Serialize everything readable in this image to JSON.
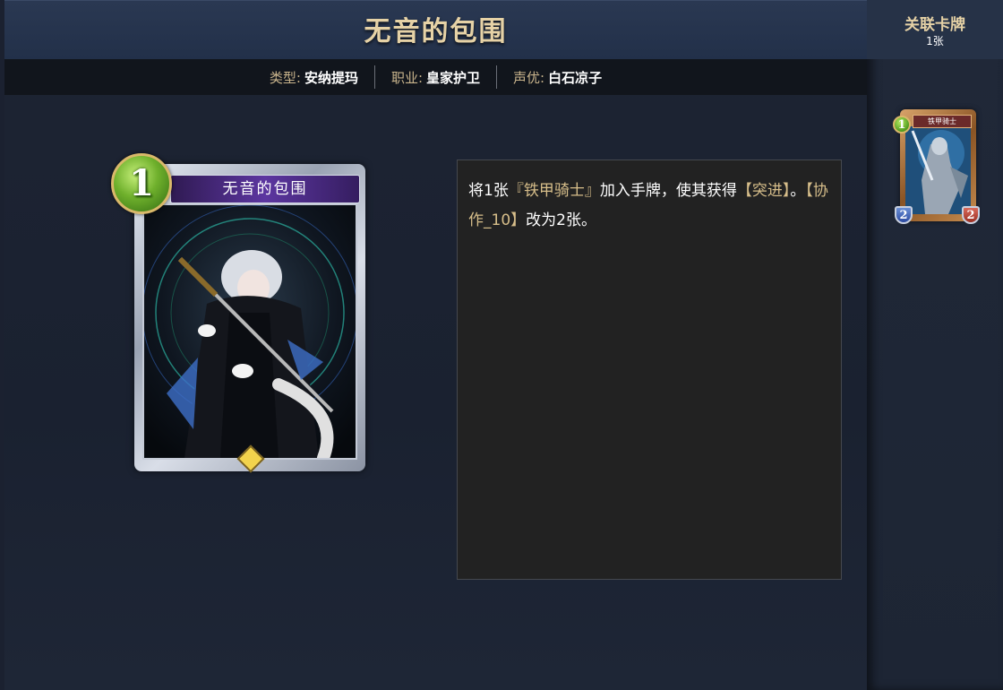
{
  "card": {
    "name": "无音的包围",
    "cost": "1"
  },
  "meta": {
    "type_label": "类型:",
    "type_value": "安纳提玛",
    "class_label": "职业:",
    "class_value": "皇家护卫",
    "cv_label": "声优:",
    "cv_value": "白石凉子"
  },
  "description": {
    "part1": "将1张",
    "linked_card": "『铁甲骑士』",
    "part2": "加入手牌，使其获得",
    "keyword1": "【突进】",
    "part3": "。",
    "keyword2": "【协作_10】",
    "part4": "改为2张。"
  },
  "related": {
    "title": "关联卡牌",
    "count": "1张",
    "cards": [
      {
        "name": "铁甲骑士",
        "cost": "1",
        "attack": "2",
        "defense": "2"
      }
    ]
  },
  "colors": {
    "gold_text": "#e6d2a6",
    "keyword_highlight": "#d7be8a",
    "cost_gem_green": "#6fb02c",
    "name_banner_purple": "#5c36a0"
  },
  "icons": {
    "rarity": "diamond-gem-icon"
  }
}
